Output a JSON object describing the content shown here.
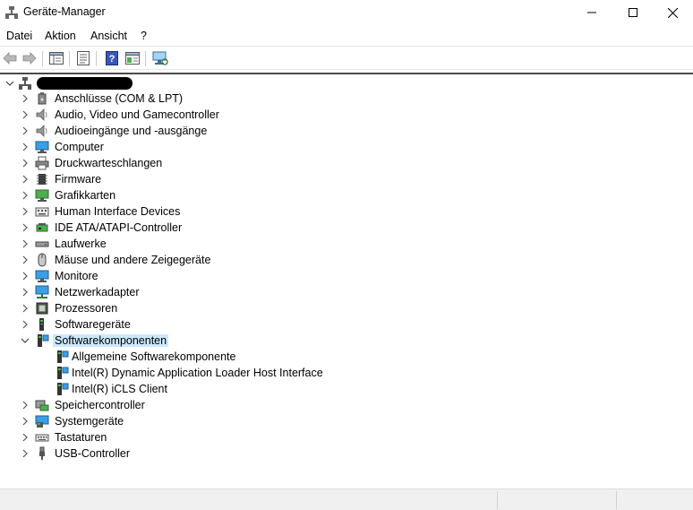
{
  "window": {
    "title": "Geräte-Manager"
  },
  "menu": {
    "items": [
      "Datei",
      "Aktion",
      "Ansicht",
      "?"
    ]
  },
  "tree": {
    "root_redacted": true,
    "categories": [
      {
        "label": "Anschlüsse (COM & LPT)",
        "icon": "port-icon",
        "expanded": false
      },
      {
        "label": "Audio, Video und Gamecontroller",
        "icon": "speaker-icon",
        "expanded": false
      },
      {
        "label": "Audioeingänge und -ausgänge",
        "icon": "speaker-icon",
        "expanded": false
      },
      {
        "label": "Computer",
        "icon": "monitor-icon",
        "expanded": false
      },
      {
        "label": "Druckwarteschlangen",
        "icon": "printer-icon",
        "expanded": false
      },
      {
        "label": "Firmware",
        "icon": "chip-icon",
        "expanded": false
      },
      {
        "label": "Grafikkarten",
        "icon": "display-adapter-icon",
        "expanded": false
      },
      {
        "label": "Human Interface Devices",
        "icon": "keyboard-icon",
        "expanded": false
      },
      {
        "label": "IDE ATA/ATAPI-Controller",
        "icon": "ide-controller-icon",
        "expanded": false
      },
      {
        "label": "Laufwerke",
        "icon": "drive-icon",
        "expanded": false
      },
      {
        "label": "Mäuse und andere Zeigegeräte",
        "icon": "mouse-icon",
        "expanded": false
      },
      {
        "label": "Monitore",
        "icon": "monitor-icon",
        "expanded": false
      },
      {
        "label": "Netzwerkadapter",
        "icon": "network-icon",
        "expanded": false
      },
      {
        "label": "Prozessoren",
        "icon": "cpu-icon",
        "expanded": false
      },
      {
        "label": "Softwaregeräte",
        "icon": "software-device-icon",
        "expanded": false
      },
      {
        "label": "Softwarekomponenten",
        "icon": "software-component-icon",
        "expanded": true,
        "selected": true,
        "children": [
          {
            "label": "Allgemeine Softwarekomponente",
            "icon": "software-component-icon"
          },
          {
            "label": "Intel(R) Dynamic Application Loader Host Interface",
            "icon": "software-component-icon"
          },
          {
            "label": "Intel(R) iCLS Client",
            "icon": "software-component-icon"
          }
        ]
      },
      {
        "label": "Speichercontroller",
        "icon": "storage-controller-icon",
        "expanded": false
      },
      {
        "label": "Systemgeräte",
        "icon": "system-device-icon",
        "expanded": false
      },
      {
        "label": "Tastaturen",
        "icon": "keyboard-icon",
        "expanded": false
      },
      {
        "label": "USB-Controller",
        "icon": "usb-icon",
        "expanded": false
      }
    ]
  },
  "colors": {
    "selection": "#cce8ff",
    "accent": "#0078d7"
  }
}
